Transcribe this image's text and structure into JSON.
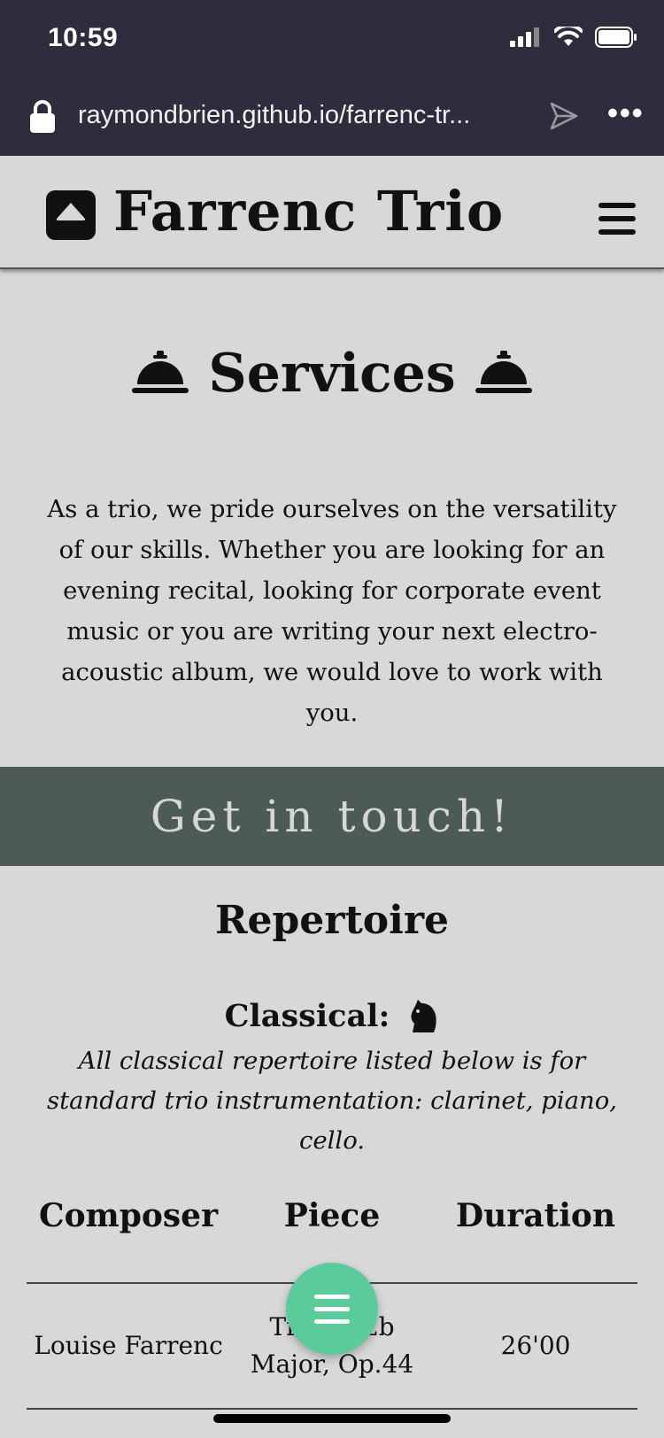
{
  "status_bar": {
    "time": "10:59"
  },
  "browser": {
    "url": "raymondbrien.github.io/farrenc-tr..."
  },
  "navbar": {
    "brand": "Farrenc Trio"
  },
  "services": {
    "title": "Services",
    "intro": "As a trio, we pride ourselves on the versatility of our skills. Whether you are looking for an evening recital, looking for corporate event music or you are writing your next electro-acoustic album, we would love to work with you."
  },
  "cta": {
    "label": "Get in touch!"
  },
  "repertoire": {
    "title": "Repertoire",
    "classical_heading": "Classical:",
    "note": "All classical repertoire listed below is for standard trio instrumentation: clarinet, piano, cello.",
    "columns": [
      "Composer",
      "Piece",
      "Duration"
    ],
    "rows": [
      {
        "composer": "Louise Farrenc",
        "piece": "Trio in Eb Major, Op.44",
        "duration": "26'00"
      }
    ]
  }
}
